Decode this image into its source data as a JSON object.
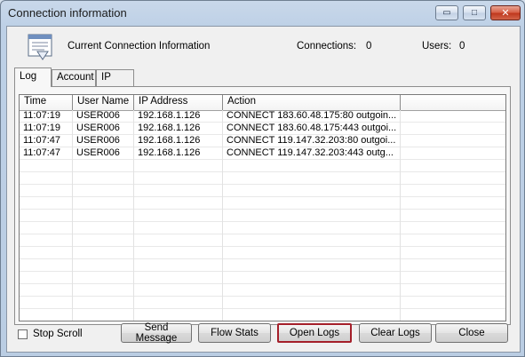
{
  "window": {
    "title": "Connection information",
    "controls": {
      "minimize": "▭",
      "maximize": "□",
      "close": "✕"
    }
  },
  "header": {
    "title": "Current Connection Information",
    "connections_label": "Connections:",
    "connections_value": "0",
    "users_label": "Users:",
    "users_value": "0",
    "icon": "connection-info-icon"
  },
  "tabs": [
    {
      "label": "Log",
      "selected": true
    },
    {
      "label": "Account",
      "selected": false
    },
    {
      "label": "IP",
      "selected": false
    }
  ],
  "table": {
    "columns": [
      "Time",
      "User Name",
      "IP Address",
      "Action",
      ""
    ],
    "rows": [
      [
        "11:07:19",
        "USER006",
        "192.168.1.126",
        "CONNECT 183.60.48.175:80 outgoin..."
      ],
      [
        "11:07:19",
        "USER006",
        "192.168.1.126",
        "CONNECT 183.60.48.175:443 outgoi..."
      ],
      [
        "11:07:47",
        "USER006",
        "192.168.1.126",
        "CONNECT 119.147.32.203:80 outgoi..."
      ],
      [
        "11:07:47",
        "USER006",
        "192.168.1.126",
        "CONNECT 119.147.32.203:443 outg..."
      ]
    ],
    "empty_row_count": 13
  },
  "footer": {
    "stop_scroll_label": "Stop Scroll",
    "stop_scroll_checked": false,
    "buttons": {
      "send_message": "Send Message",
      "flow_stats": "Flow Stats",
      "open_logs": "Open Logs",
      "clear_logs": "Clear Logs",
      "close": "Close"
    }
  },
  "colors": {
    "focus_border": "#a51f2a",
    "close_button": "#c0391f"
  }
}
